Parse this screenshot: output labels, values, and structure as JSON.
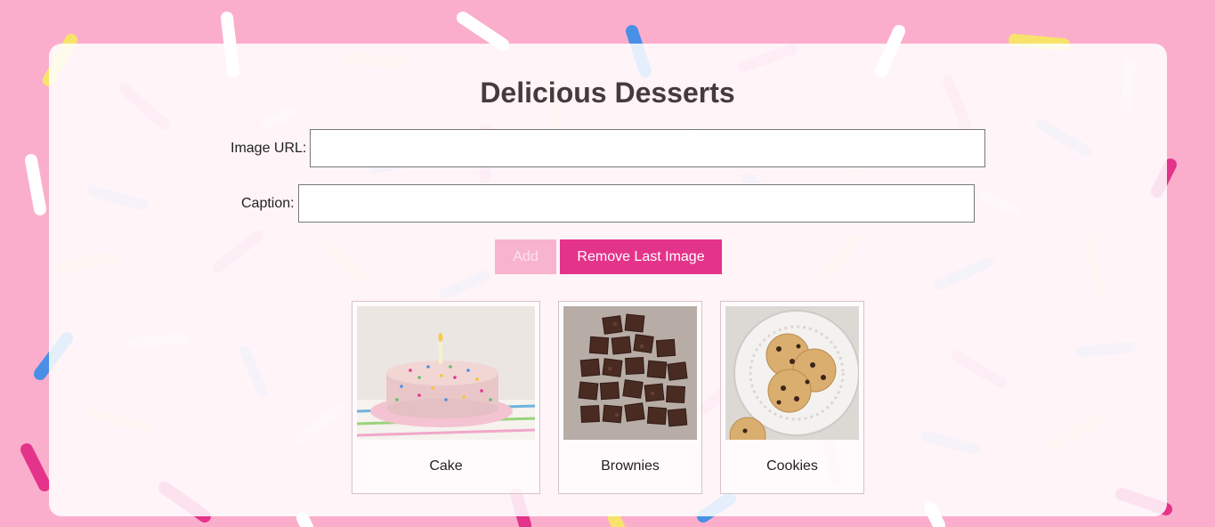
{
  "page": {
    "title": "Delicious Desserts"
  },
  "form": {
    "url_label": "Image URL:",
    "url_value": "",
    "caption_label": "Caption:",
    "caption_value": "",
    "add_label": "Add",
    "remove_label": "Remove Last Image"
  },
  "gallery": [
    {
      "caption": "Cake"
    },
    {
      "caption": "Brownies"
    },
    {
      "caption": "Cookies"
    }
  ],
  "colors": {
    "background": "#fbaecb",
    "accent": "#e4338a",
    "accent_disabled": "#f8b3cf",
    "title": "#443b3d"
  }
}
